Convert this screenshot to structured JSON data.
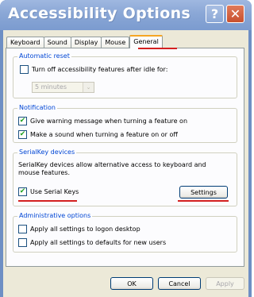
{
  "window": {
    "title": "Accessibility Options"
  },
  "titlebar": {
    "help_label": "?",
    "close_label": "✕"
  },
  "tabs": [
    {
      "label": "Keyboard"
    },
    {
      "label": "Sound"
    },
    {
      "label": "Display"
    },
    {
      "label": "Mouse"
    },
    {
      "label": "General",
      "active": true
    }
  ],
  "automatic_reset": {
    "legend": "Automatic reset",
    "checkbox_label": "Turn off accessibility features after idle for:",
    "checked": false,
    "idle_value": "5 minutes",
    "combo_arrow": "⌄"
  },
  "notification": {
    "legend": "Notification",
    "items": [
      {
        "label": "Give warning message when turning a feature on",
        "checked": true
      },
      {
        "label": "Make a sound when turning a feature on or off",
        "checked": true
      }
    ]
  },
  "serialkey": {
    "legend": "SerialKey devices",
    "description_line1": "SerialKey devices allow alternative access to keyboard and",
    "description_line2": "mouse features.",
    "checkbox_label": "Use Serial Keys",
    "checked": true,
    "settings_label": "Settings"
  },
  "administrative": {
    "legend": "Administrative options",
    "items": [
      {
        "label": "Apply all settings to logon desktop",
        "checked": false
      },
      {
        "label": "Apply all settings to defaults for new users",
        "checked": false
      }
    ]
  },
  "footer": {
    "ok_label": "OK",
    "cancel_label": "Cancel",
    "apply_label": "Apply"
  },
  "checkmark": "✔",
  "colors": {
    "accent_underline": "#d42020",
    "group_legend": "#0046d5",
    "check": "#21a121"
  }
}
